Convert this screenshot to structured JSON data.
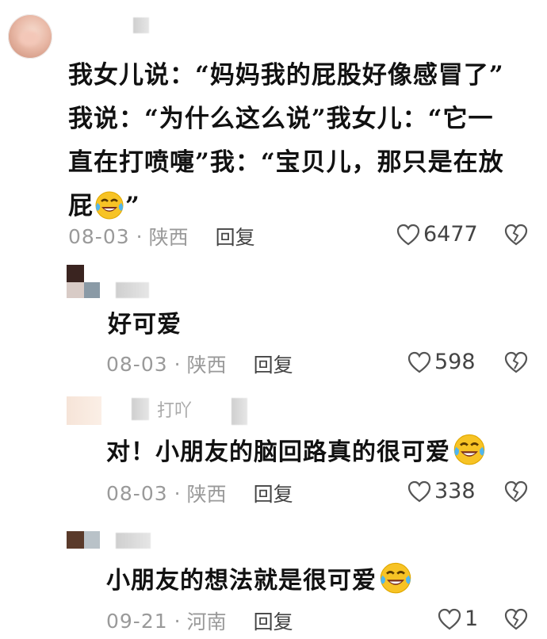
{
  "comment": {
    "text": "我女儿说：“妈妈我的屁股好像感冒了”我说：“为什么这么说”我女儿：“它一直在打喷嚏”我：“宝贝儿，那只是在放屁",
    "line1": "我女儿说：“妈妈我的屁股好像感冒了”",
    "line2": "我说：“为什么这么说”我女儿：“它一",
    "line3": "直在打喷嚏”我：“宝贝儿，那只是在放",
    "line4_prefix": "屁",
    "line4_suffix": "”",
    "date": "08-03",
    "dot": "·",
    "location": "陕西",
    "reply_label": "回复",
    "likes": "6477"
  },
  "replies": [
    {
      "text": "好可爱",
      "date": "08-03",
      "location": "陕西",
      "reply_label": "回复",
      "likes": "598"
    },
    {
      "username_partial": "打吖",
      "text": "对！小朋友的脑回路真的很可爱",
      "date": "08-03",
      "location": "陕西",
      "reply_label": "回复",
      "likes": "338"
    },
    {
      "text": "小朋友的想法就是很可爱",
      "date": "09-21",
      "location": "河南",
      "reply_label": "回复",
      "likes": "1"
    }
  ],
  "colors": {
    "meta_gray": "#9a9a9a",
    "text": "#111111",
    "icon": "#555555",
    "emoji_yellow": "#f7c325"
  },
  "icons": [
    "heart-outline-icon",
    "broken-heart-icon",
    "crying-laughing-emoji"
  ]
}
